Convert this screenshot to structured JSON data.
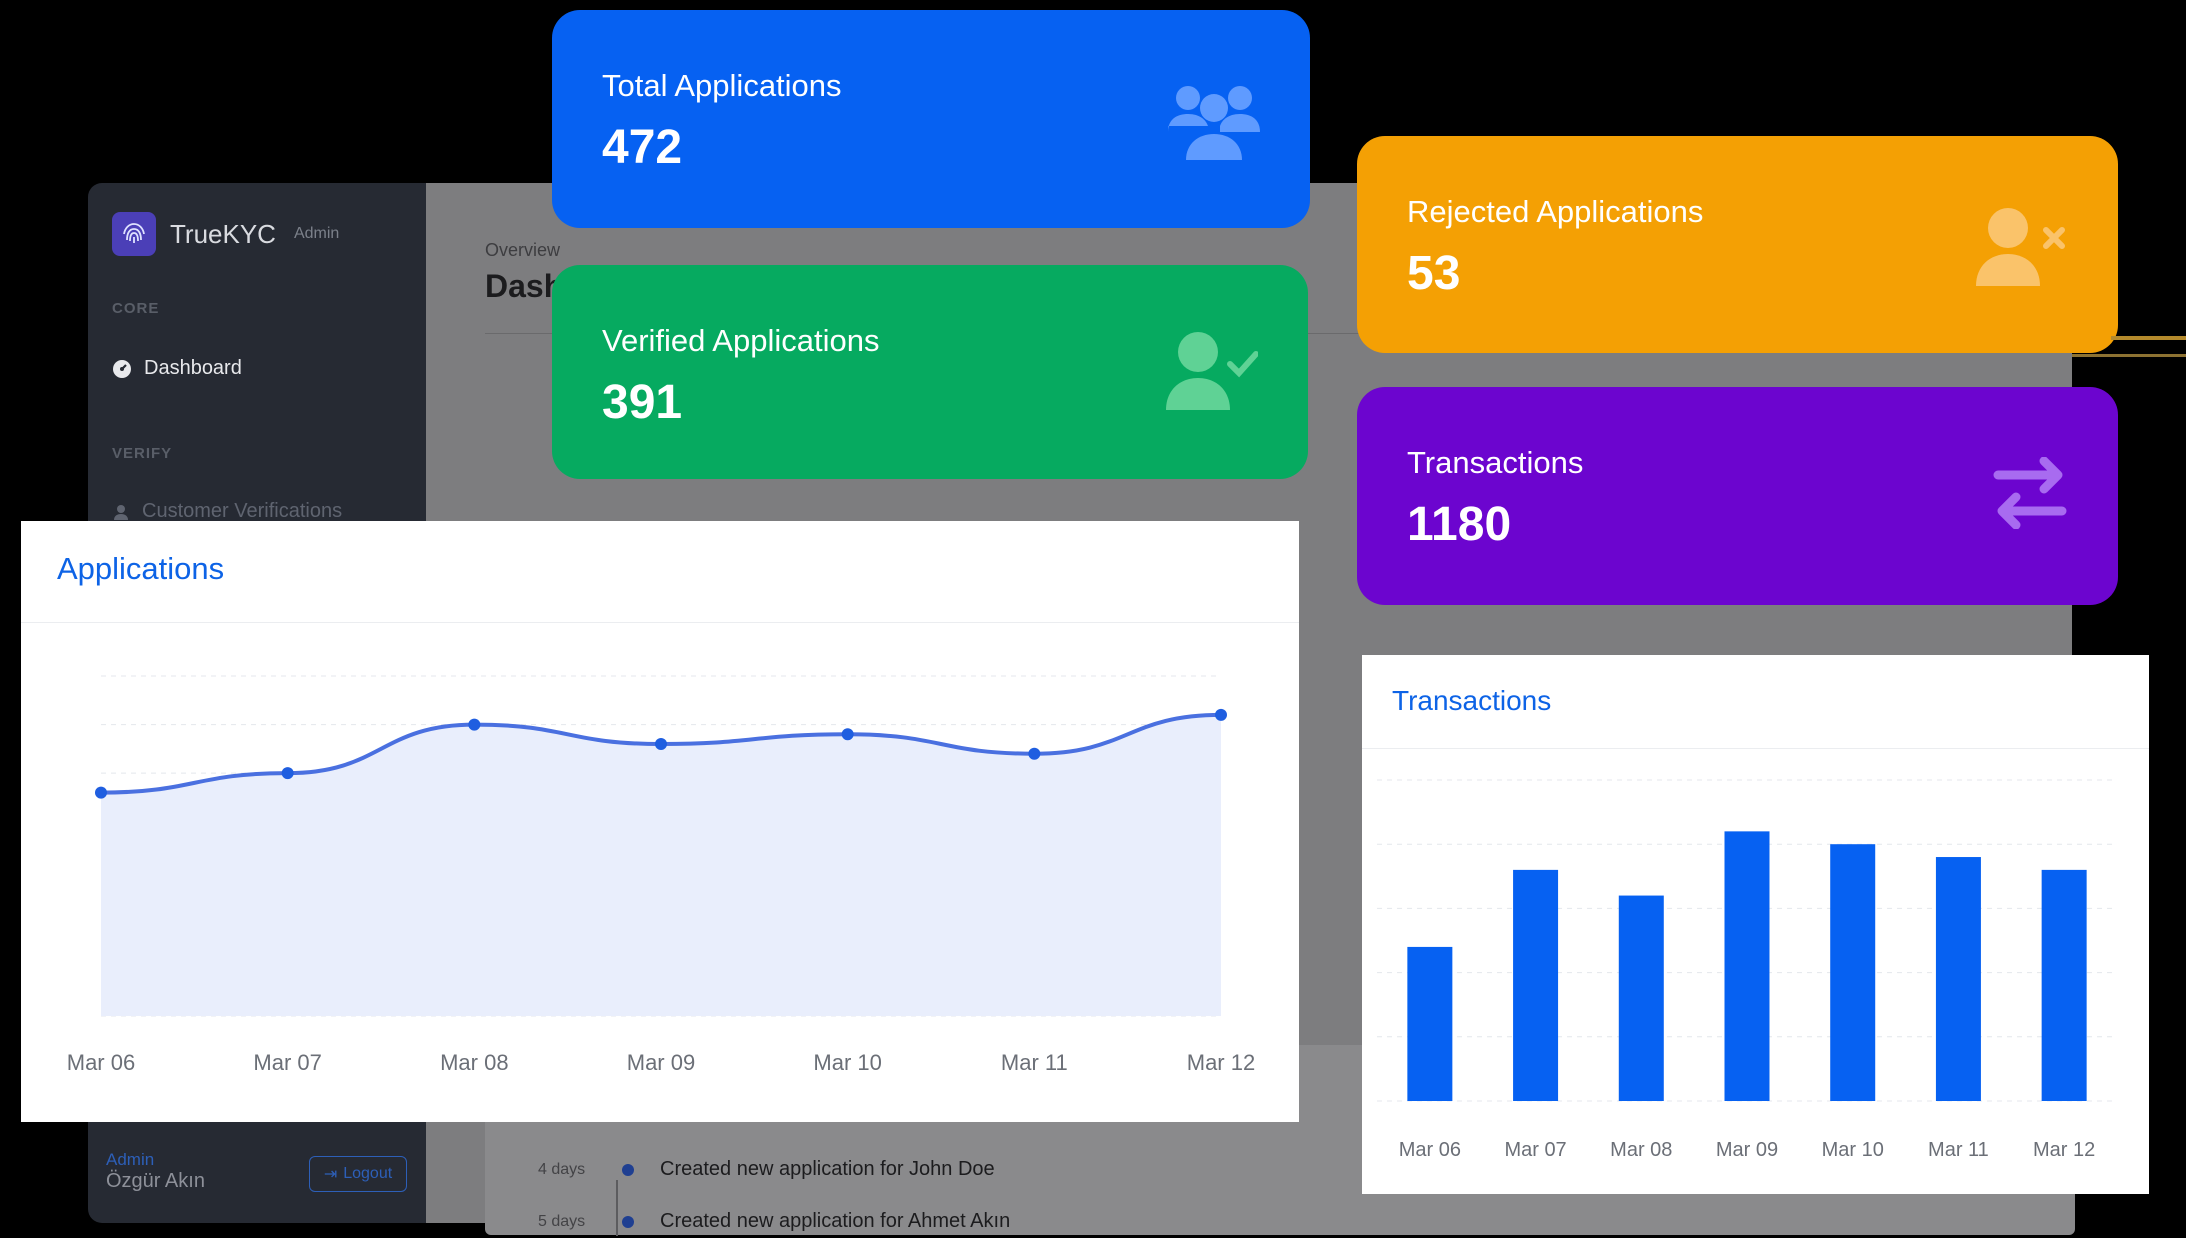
{
  "sidebar": {
    "brand": "TrueKYC",
    "brand_suffix": "Admin",
    "sections": [
      {
        "heading": "CORE",
        "items": [
          {
            "label": "Dashboard",
            "icon": "dashboard-gauge-icon"
          }
        ]
      },
      {
        "heading": "VERIFY",
        "items": [
          {
            "label": "Customer Verifications",
            "icon": "user-icon"
          }
        ]
      }
    ],
    "footer": {
      "role": "Admin",
      "user": "Özgür Akın",
      "logout_label": "Logout"
    }
  },
  "header": {
    "overview": "Overview",
    "title": "Dash"
  },
  "cards": [
    {
      "label": "Total Applications",
      "value": "472",
      "color": "#0661f2",
      "icon": "users-group-icon"
    },
    {
      "label": "Verified Applications",
      "value": "391",
      "color": "#06aa60",
      "icon": "user-check-icon"
    },
    {
      "label": "Rejected Applications",
      "value": "53",
      "color": "#f4a004",
      "icon": "user-x-icon"
    },
    {
      "label": "Transactions",
      "value": "1180",
      "color": "#6c05cf",
      "icon": "arrows-exchange-icon"
    }
  ],
  "activity": [
    {
      "time": "4 days",
      "text": "Created new application for John Doe"
    },
    {
      "time": "5 days",
      "text": "Created new application for Ahmet Akın"
    }
  ],
  "chart_data": [
    {
      "type": "area",
      "title": "Applications",
      "categories": [
        "Mar 06",
        "Mar 07",
        "Mar 08",
        "Mar 09",
        "Mar 10",
        "Mar 11",
        "Mar 12"
      ],
      "values": [
        46,
        50,
        60,
        56,
        58,
        54,
        62
      ],
      "ylim": [
        0,
        70
      ],
      "grid": true,
      "color": "#4a70e0",
      "fill": "#e9eefc"
    },
    {
      "type": "bar",
      "title": "Transactions",
      "categories": [
        "Mar 06",
        "Mar 07",
        "Mar 08",
        "Mar 09",
        "Mar 10",
        "Mar 11",
        "Mar 12"
      ],
      "values": [
        120,
        180,
        160,
        210,
        200,
        190,
        180
      ],
      "ylim": [
        0,
        250
      ],
      "grid": true,
      "color": "#0661f2"
    }
  ]
}
